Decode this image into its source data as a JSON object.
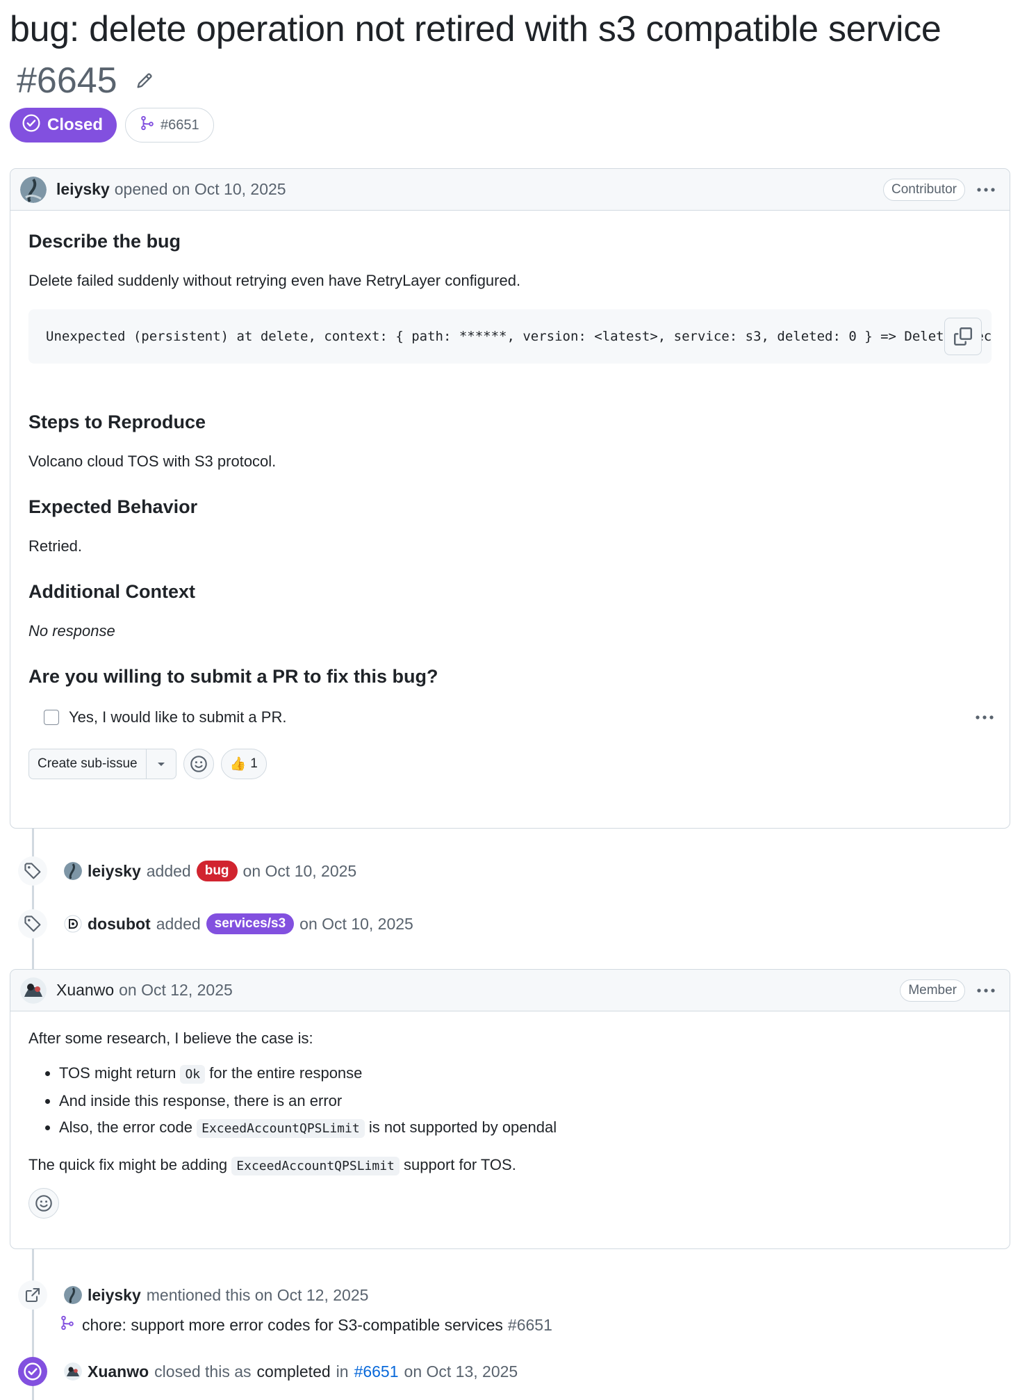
{
  "issue": {
    "title": "bug: delete operation not retired with s3 compatible service",
    "number": "#6645",
    "state": "Closed",
    "linked_pr": "#6651"
  },
  "opening_comment": {
    "author": "leiysky",
    "action_text": "opened on Oct 10, 2025",
    "role": "Contributor",
    "sections": {
      "describe_heading": "Describe the bug",
      "describe_text": "Delete failed suddenly without retrying even have RetryLayer configured.",
      "code": "Unexpected (persistent) at delete, context: { path: ******, version: <latest>, service: s3, deleted: 0 } => DeleteObjects",
      "steps_heading": "Steps to Reproduce",
      "steps_text": "Volcano cloud TOS with S3 protocol.",
      "expected_heading": "Expected Behavior",
      "expected_text": "Retried.",
      "context_heading": "Additional Context",
      "context_text": "No response",
      "pr_heading": "Are you willing to submit a PR to fix this bug?",
      "pr_task": "Yes, I would like to submit a PR."
    },
    "create_sub_issue_label": "Create sub-issue",
    "reaction": {
      "emoji": "👍",
      "count": "1"
    }
  },
  "events": [
    {
      "actor": "leiysky",
      "verb": "added",
      "label": "bug",
      "label_color": "#d1242f",
      "date": "on Oct 10, 2025"
    },
    {
      "actor": "dosubot",
      "verb": "added",
      "label": "services/s3",
      "label_color": "#8250df",
      "date": "on Oct 10, 2025"
    }
  ],
  "member_comment": {
    "author": "Xuanwo",
    "date": "on Oct 12, 2025",
    "role": "Member",
    "intro": "After some research, I believe the case is:",
    "bullets": [
      {
        "before": "TOS might return",
        "code": "Ok",
        "after": "for the entire response"
      },
      {
        "before": "And inside this response, there is an error",
        "code": "",
        "after": ""
      },
      {
        "before": "Also, the error code",
        "code": "ExceedAccountQPSLimit",
        "after": "is not supported by opendal"
      }
    ],
    "conclusion_before": "The quick fix might be adding",
    "conclusion_code": "ExceedAccountQPSLimit",
    "conclusion_after": "support for TOS."
  },
  "mention_event": {
    "actor": "leiysky",
    "text": "mentioned this on Oct 12, 2025",
    "pr_title": "chore: support more error codes for S3-compatible services",
    "pr_number": "#6651"
  },
  "closed_event": {
    "actor": "Xuanwo",
    "text_before": "closed this as",
    "status": "completed",
    "text_in": "in",
    "pr_number": "#6651",
    "date": "on Oct 13, 2025"
  }
}
